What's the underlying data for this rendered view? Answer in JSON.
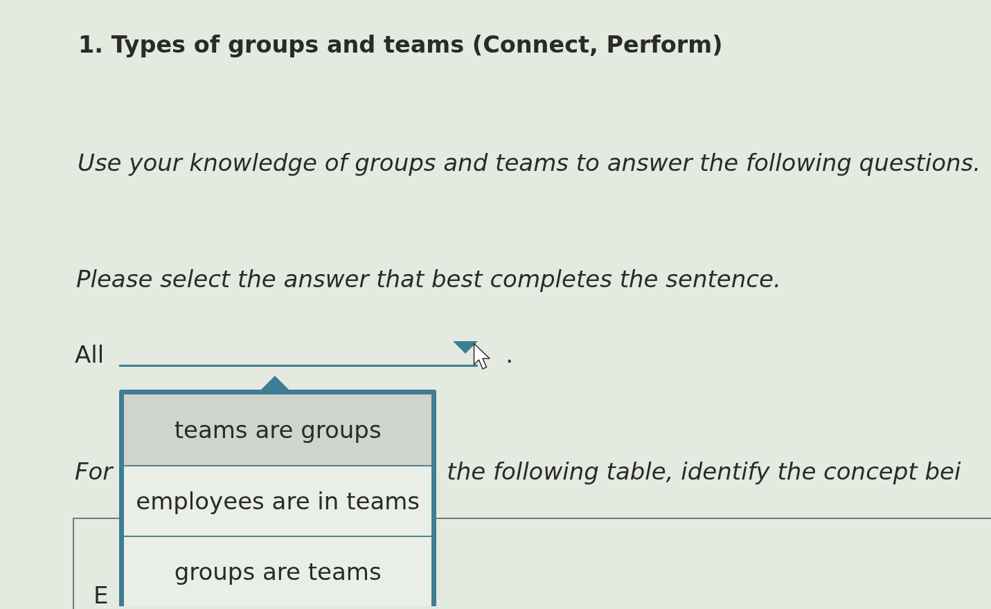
{
  "title": "1. Types of groups and teams (Connect, Perform)",
  "instructions": "Use your knowledge of groups and teams to answer the following questions.",
  "prompt": "Please select the answer that best completes the sentence.",
  "sentence": {
    "before": "All",
    "after": ".",
    "dropdown": {
      "expanded": true,
      "options": [
        {
          "label": "teams are groups",
          "selected": true
        },
        {
          "label": "employees are in teams",
          "selected": false
        },
        {
          "label": "groups are teams",
          "selected": false
        }
      ]
    }
  },
  "table_intro": {
    "before": "For",
    "after": "the following table, identify the concept bei"
  },
  "table": {
    "cells": [
      "E"
    ]
  }
}
